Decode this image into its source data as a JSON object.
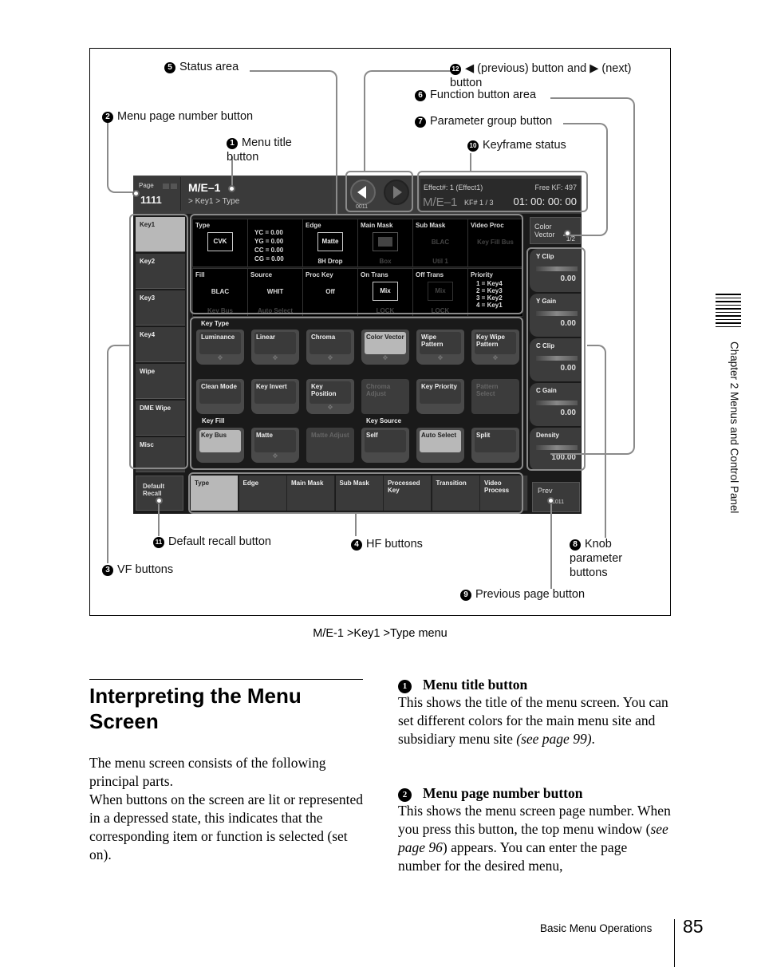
{
  "callouts": {
    "c1": {
      "num": "1",
      "label": "Menu title button"
    },
    "c2": {
      "num": "2",
      "label": "Menu page number button"
    },
    "c3": {
      "num": "3",
      "label": "VF buttons"
    },
    "c4": {
      "num": "4",
      "label": "HF buttons"
    },
    "c5": {
      "num": "5",
      "label": "Status area"
    },
    "c6": {
      "num": "6",
      "label": "Function button area"
    },
    "c7": {
      "num": "7",
      "label": "Parameter group button"
    },
    "c8": {
      "num": "8",
      "label": "Knob parameter buttons"
    },
    "c9": {
      "num": "9",
      "label": "Previous page button"
    },
    "c10": {
      "num": "10",
      "label": "Keyframe status"
    },
    "c11": {
      "num": "11",
      "label": "Default recall button"
    },
    "c12": {
      "num": "12",
      "label": "◀ (previous) button and ▶ (next) button"
    }
  },
  "screen": {
    "page_label": "Page",
    "page_number": "1111",
    "menu_title": "M/E–1",
    "menu_path": "> Key1 > Type",
    "nav_number": "0011",
    "status": {
      "effect": "Effect#: 1 (Effect1)",
      "free_kf": "Free KF: 497",
      "me": "M/E–1",
      "kf": "KF# 1 / 3",
      "timecode": "01: 00: 00: 00"
    },
    "vf_buttons": [
      "Key1",
      "Key2",
      "Key3",
      "Key4",
      "Wipe",
      "DME Wipe",
      "Misc"
    ],
    "status_cells": [
      {
        "header": "Type",
        "box": "CVK"
      },
      {
        "header": "",
        "lines": [
          "YC  = 0.00",
          "YG  = 0.00",
          "CC  = 0.00",
          "CG  = 0.00"
        ]
      },
      {
        "header": "Edge",
        "box": "Matte",
        "sub": "8H Drop"
      },
      {
        "header": "Main Mask",
        "sub": "Box"
      },
      {
        "header": "Sub Mask",
        "value": "BLAC",
        "sub": "Util 1"
      },
      {
        "header": "Video Proc",
        "value": "Key Fill Bus"
      },
      {
        "header": "Fill",
        "value": "BLAC",
        "sub": "Key Bus"
      },
      {
        "header": "Source",
        "value": "WHIT",
        "sub": "Auto Select"
      },
      {
        "header": "Proc Key",
        "value": "Off"
      },
      {
        "header": "On Trans",
        "box": "Mix",
        "sub": "LOCK"
      },
      {
        "header": "Off Trans",
        "box": "Mix",
        "sub": "LOCK"
      },
      {
        "header": "Priority",
        "lines": [
          "1  = Key4",
          "2  = Key3",
          "3  = Key2",
          "4  = Key1"
        ]
      }
    ],
    "groups": {
      "key_type": "Key Type",
      "key_fill": "Key Fill",
      "key_source": "Key Source"
    },
    "function_buttons_row1": [
      "Luminance",
      "Linear",
      "Chroma",
      "Color Vector",
      "Wipe Pattern",
      "Key Wipe Pattern"
    ],
    "function_buttons_row2": [
      "Clean Mode",
      "Key Invert",
      "Key Position",
      "Chroma Adjust",
      "Key Priority",
      "Pattern Select"
    ],
    "function_buttons_row3": [
      "Key Bus",
      "Matte",
      "Matte Adjust",
      "Self",
      "Auto Select",
      "Split"
    ],
    "param_group": {
      "label": "Color Vector",
      "page": "1/2"
    },
    "knobs": [
      {
        "name": "Y Clip",
        "value": "0.00"
      },
      {
        "name": "Y Gain",
        "value": "0.00"
      },
      {
        "name": "C Clip",
        "value": "0.00"
      },
      {
        "name": "C Gain",
        "value": "0.00"
      },
      {
        "name": "Density",
        "value": "100.00"
      }
    ],
    "default_recall": "Default Recall",
    "hf_buttons": [
      "Type",
      "Edge",
      "Main Mask",
      "Sub Mask",
      "Processed Key",
      "Transition",
      "Video Process"
    ],
    "prev": {
      "label": "Prev",
      "page": "1011"
    }
  },
  "caption": "M/E-1 >Key1 >Type menu",
  "section": {
    "title_line1": "Interpreting the Menu",
    "title_line2": "Screen",
    "intro1": "The menu screen consists of the following principal parts.",
    "intro2": "When buttons on the screen are lit or represented in a depressed state, this indicates that the corresponding item or function is selected (set on).",
    "items": [
      {
        "num": "1",
        "title": "Menu title button",
        "text": "This shows the title of the menu screen. You can set different colors for the main menu site and subsidiary menu site ",
        "ref": "(see page 99)",
        "tail": "."
      },
      {
        "num": "2",
        "title": "Menu page number button",
        "text": "This shows the menu screen page number. When you press this button, the top menu window (",
        "ref": "see page 96",
        "tail": ") appears. You can enter the page number for the desired menu,"
      }
    ]
  },
  "side_tab": "Chapter 2  Menus and Control Panel",
  "footer": {
    "section": "Basic Menu Operations",
    "page": "85"
  }
}
